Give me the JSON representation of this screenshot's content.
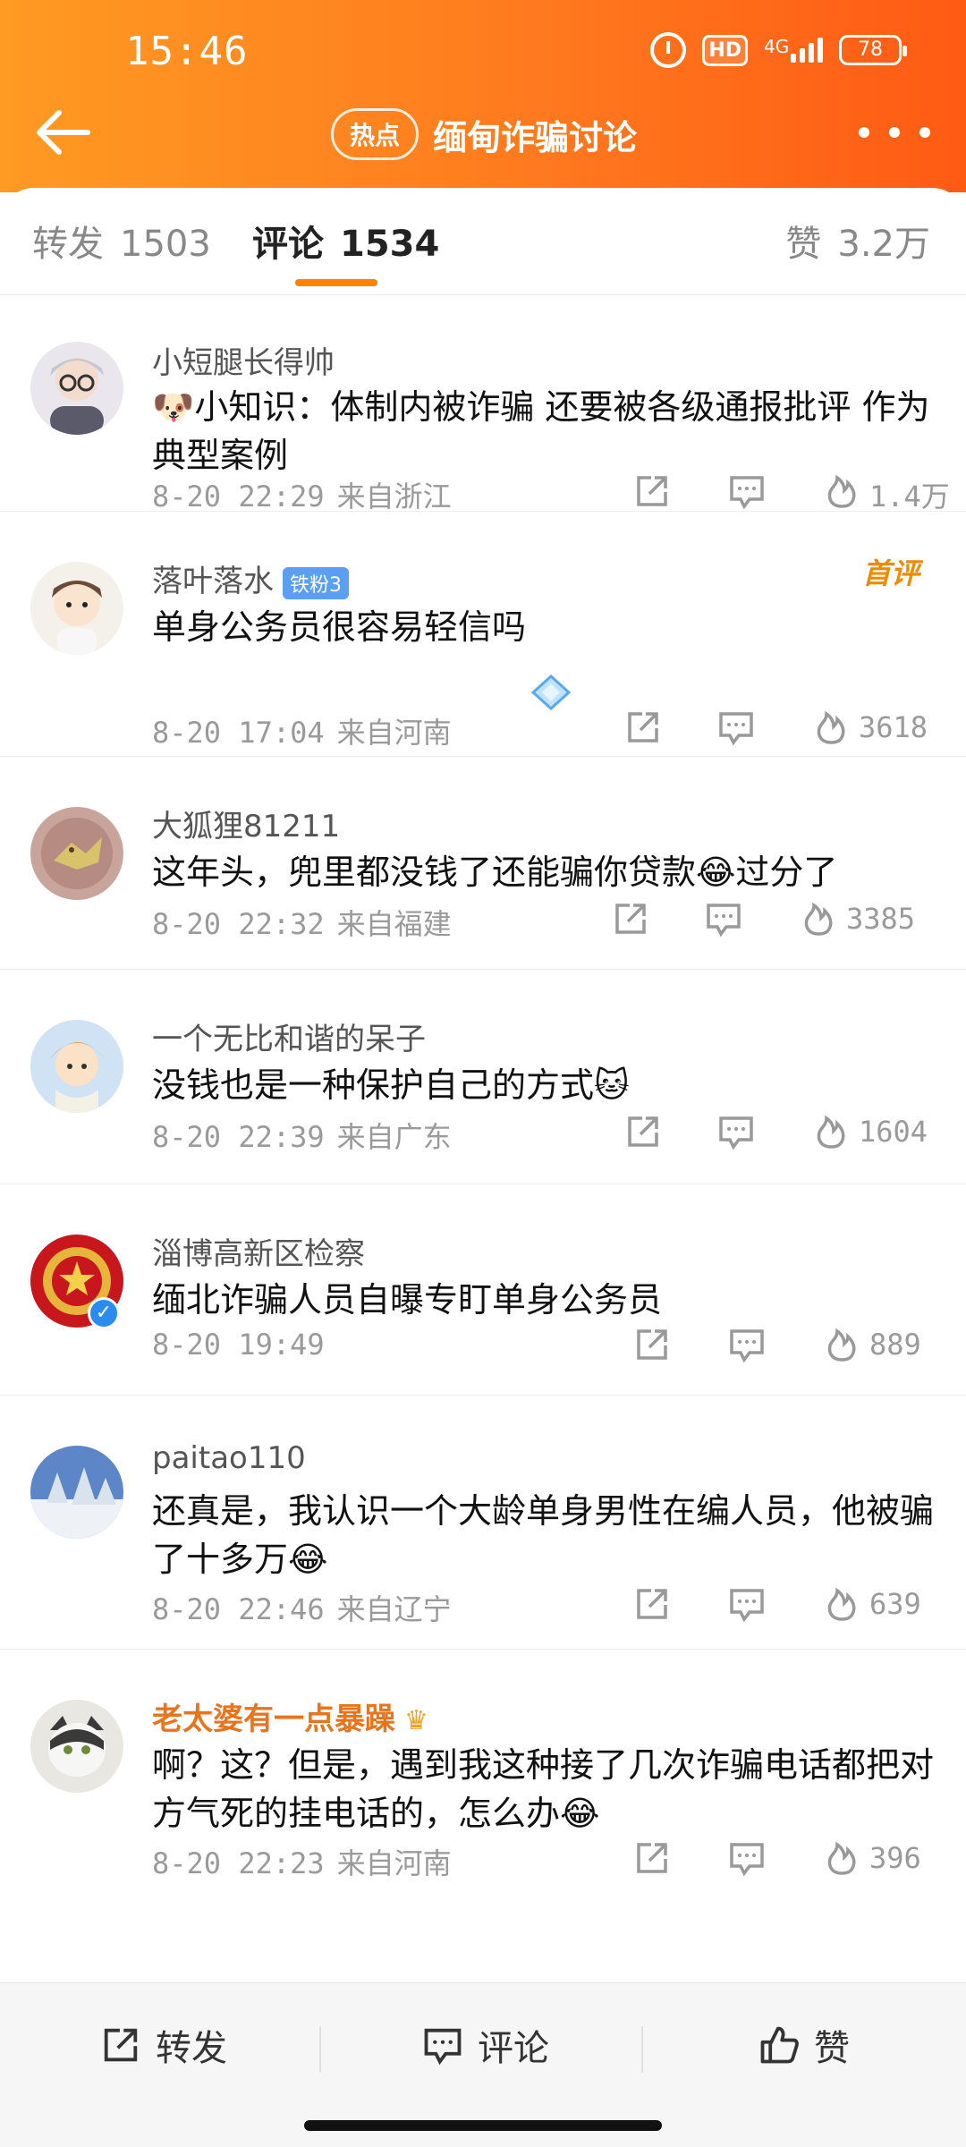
{
  "status_bar": {
    "time": "15:46",
    "hd": "HD",
    "network": "4G",
    "battery": "78"
  },
  "header": {
    "hot_badge": "热点",
    "title": "缅甸诈骗讨论",
    "back_icon": "back-arrow-icon",
    "more_icon": "more-dots-icon"
  },
  "tabs": {
    "repost": {
      "label": "转发",
      "count": "1503"
    },
    "comment": {
      "label": "评论",
      "count": "1534"
    },
    "like": {
      "label": "赞",
      "count": "3.2万"
    }
  },
  "comments": [
    {
      "user": "小短腿长得帅",
      "text": "🐶小知识：体制内被诈骗 还要被各级通报批评 作为典型案例",
      "time": "8-20 22:29",
      "location": "来自浙江",
      "likes": "1.4万"
    },
    {
      "user": "落叶落水",
      "badge": "铁粉3",
      "first": "首评",
      "text": "单身公务员很容易轻信吗",
      "time": "8-20 17:04",
      "location": "来自河南",
      "likes": "3618"
    },
    {
      "user": "大狐狸81211",
      "text": "这年头，兜里都没钱了还能骗你贷款😂过分了",
      "time": "8-20 22:32",
      "location": "来自福建",
      "likes": "3385"
    },
    {
      "user": "一个无比和谐的呆子",
      "text": "没钱也是一种保护自己的方式🐱",
      "time": "8-20 22:39",
      "location": "来自广东",
      "likes": "1604"
    },
    {
      "user": "淄博高新区检察",
      "text": "缅北诈骗人员自曝专盯单身公务员",
      "time": "8-20 19:49",
      "location": "",
      "likes": "889"
    },
    {
      "user": "paitao110",
      "text": "还真是，我认识一个大龄单身男性在编人员，他被骗了十多万😂",
      "time": "8-20 22:46",
      "location": "来自辽宁",
      "likes": "639"
    },
    {
      "user": "老太婆有一点暴躁",
      "text": "啊？这？但是，遇到我这种接了几次诈骗电话都把对方气死的挂电话的，怎么办😂",
      "time": "8-20 22:23",
      "location": "来自河南",
      "likes": "396"
    }
  ],
  "bottom_bar": {
    "repost": "转发",
    "comment": "评论",
    "like": "赞"
  },
  "colors": {
    "accent": "#ff8200",
    "header_start": "#ff9a22",
    "header_end": "#ff5a14",
    "meta_gray": "#9a9a9a"
  }
}
